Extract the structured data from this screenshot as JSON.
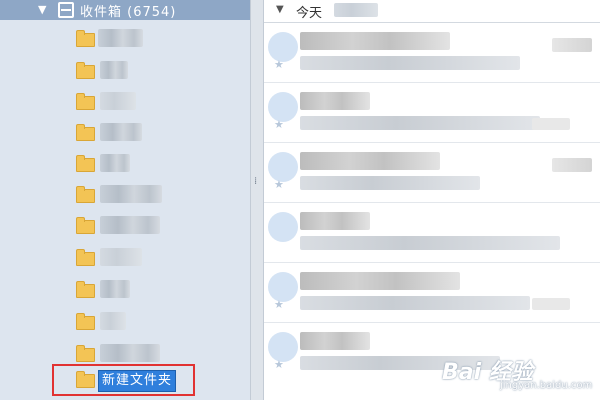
{
  "inbox": {
    "label": "收件箱 (6754)"
  },
  "folders": [
    {
      "blur": [
        [
          98,
          45
        ],
        [
          144,
          6
        ]
      ]
    },
    {
      "blur": [
        [
          100,
          42
        ]
      ]
    },
    {
      "blur": [
        [
          100,
          36
        ]
      ]
    },
    {
      "blur": [
        [
          100,
          42
        ]
      ]
    },
    {
      "blur": [
        [
          100,
          42
        ]
      ]
    },
    {
      "blur": [
        [
          100,
          60
        ]
      ]
    },
    {
      "blur": [
        [
          100,
          60
        ]
      ]
    },
    {
      "blur": [
        [
          100,
          42
        ]
      ]
    },
    {
      "blur": [
        [
          100,
          42
        ]
      ]
    },
    {
      "blur": [
        [
          100,
          30
        ]
      ]
    },
    {
      "blur": [
        [
          100,
          60
        ]
      ]
    }
  ],
  "new_folder": {
    "input_value": "新建文件夹"
  },
  "message_list": {
    "group_label": "今天"
  },
  "watermark": {
    "brand": "Bai 经验",
    "url": "jingyan.baidu.com"
  }
}
